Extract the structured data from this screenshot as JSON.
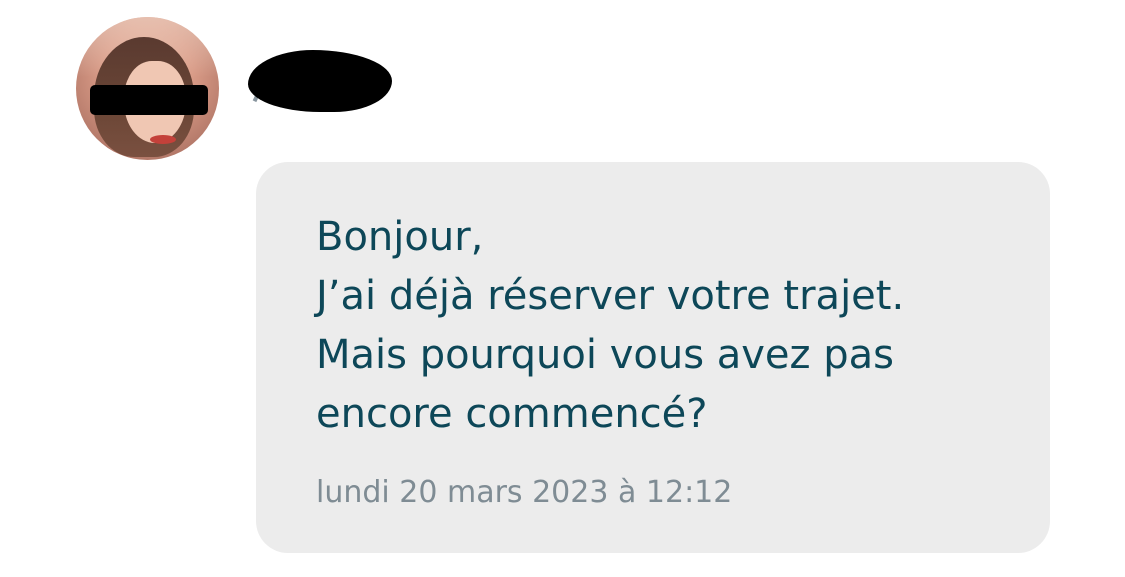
{
  "message": {
    "lines": [
      "Bonjour,",
      "J’ai déjà réserver votre trajet.",
      "Mais pourquoi vous avez pas",
      "encore commencé?"
    ],
    "timestamp": "lundi 20 mars 2023 à 12:12"
  },
  "colors": {
    "bubble": "#ececec",
    "message_text": "#0d4758",
    "timestamp_text": "#7f8c94",
    "redaction": "#000000"
  }
}
